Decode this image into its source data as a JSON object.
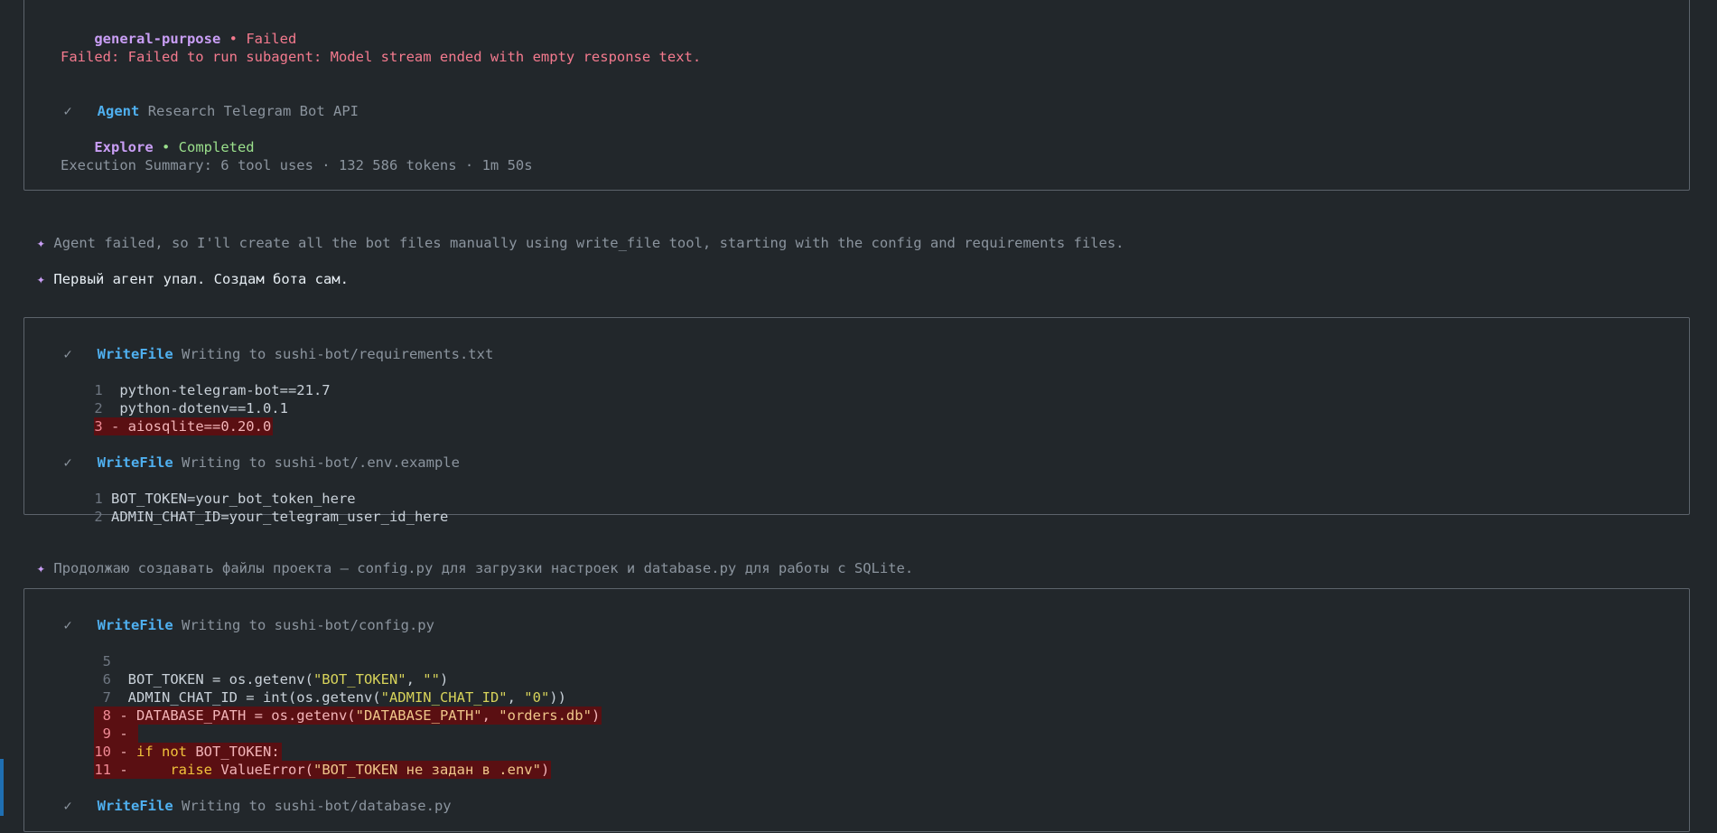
{
  "block1": {
    "agent1_name": "general-purpose",
    "agent1_sep": " • ",
    "agent1_status": "Failed",
    "failed_message": "Failed: Failed to run subagent: Model stream ended with empty response text.",
    "check": "✓",
    "agent_label": "Agent",
    "agent_desc": "Research Telegram Bot API",
    "agent2_name": "Explore",
    "agent2_sep": " • ",
    "agent2_status": "Completed",
    "summary": "Execution Summary: 6 tool uses · 132 586 tokens · 1m 50s"
  },
  "notes": {
    "star": "✦",
    "note1": "Agent failed, so I'll create all the bot files manually using write_file tool, starting with the config and requirements files.",
    "note2": "Первый агент упал. Создам бота сам.",
    "note3": "Продолжаю создавать файлы проекта — config.py для загрузки настроек и database.py для работы с SQLite."
  },
  "block2": {
    "check": "✓",
    "tool": "WriteFile",
    "file1_desc": "Writing to sushi-bot/requirements.txt",
    "file1_lines": [
      {
        "num": "1",
        "text": "  python-telegram-bot==21.7"
      },
      {
        "num": "2",
        "text": "  python-dotenv==1.0.1"
      },
      {
        "num": "3",
        "text": " - aiosqlite==0.20.0"
      }
    ],
    "file2_desc": "Writing to sushi-bot/.env.example",
    "file2_lines": [
      {
        "num": "1",
        "text": "BOT_TOKEN=your_bot_token_here"
      },
      {
        "num": "2",
        "text": "ADMIN_CHAT_ID=your_telegram_user_id_here"
      }
    ]
  },
  "block3": {
    "check": "✓",
    "tool": "WriteFile",
    "file1_desc": "Writing to sushi-bot/config.py",
    "l5_num": " 5",
    "l6_num": " 6",
    "l6_a": "  BOT_TOKEN = os.getenv(",
    "l6_s1": "\"BOT_TOKEN\"",
    "l6_b": ", ",
    "l6_s2": "\"\"",
    "l6_c": ")",
    "l7_num": " 7",
    "l7_a": "  ADMIN_CHAT_ID = int(os.getenv(",
    "l7_s1": "\"ADMIN_CHAT_ID\"",
    "l7_b": ", ",
    "l7_s2": "\"0\"",
    "l7_c": "))",
    "l8_num": " 8",
    "l8_a": " - DATABASE_PATH = os.getenv(",
    "l8_s1": "\"DATABASE_PATH\"",
    "l8_b": ", ",
    "l8_s2": "\"orders.db\"",
    "l8_c": ")",
    "l9_num": " 9",
    "l9_a": " - ",
    "l10_num": "10",
    "l10_a": " - ",
    "l10_kw1": "if not",
    "l10_b": " BOT_TOKEN:",
    "l11_num": "11",
    "l11_a": " -     ",
    "l11_kw": "raise",
    "l11_b": " ValueError(",
    "l11_s": "\"BOT_TOKEN не задан в .env\"",
    "l11_c": ")",
    "file2_desc": "Writing to sushi-bot/database.py"
  },
  "colors": {
    "background": "#22272b",
    "tool_blue": "#4fb0f0",
    "agent_purple": "#c99ef5",
    "failed_red": "#f47a8e",
    "completed_green": "#9be08c",
    "deleted_line_bg": "#5a0f12",
    "string_yellow": "#d7d35a",
    "scroll_indicator": "#1f6fb2"
  }
}
